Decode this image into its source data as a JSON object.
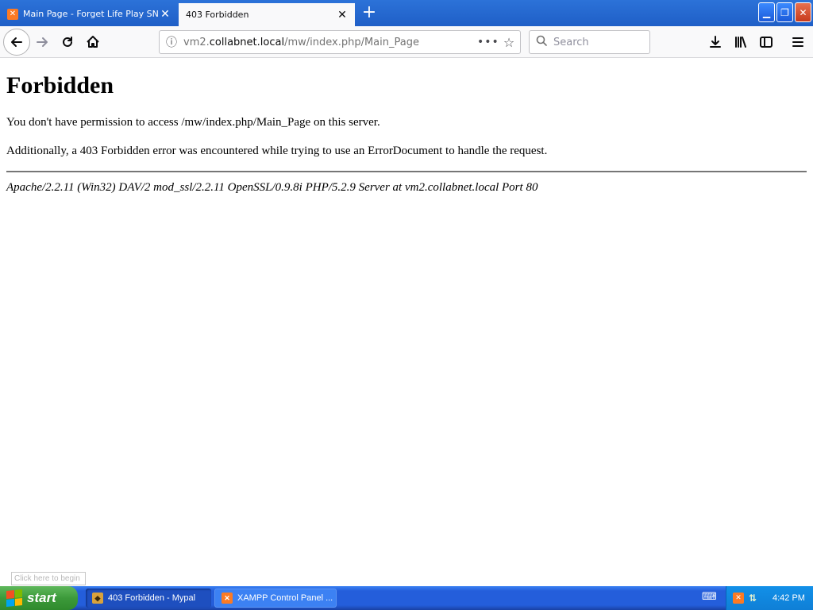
{
  "browser": {
    "tabs": [
      {
        "label": "Main Page - Forget Life Play SNOO",
        "favicon": "xampp-icon",
        "active": false
      },
      {
        "label": "403 Forbidden",
        "favicon": "",
        "active": true
      }
    ],
    "urlbar": {
      "prefix": "vm2.",
      "domain": "collabnet.local",
      "path": "/mw/index.php/Main_Page"
    },
    "search": {
      "placeholder": "Search"
    }
  },
  "page": {
    "heading": "Forbidden",
    "message1": "You don't have permission to access /mw/index.php/Main_Page on this server.",
    "message2": "Additionally, a 403 Forbidden error was encountered while trying to use an ErrorDocument to handle the request.",
    "server_signature": "Apache/2.2.11 (Win32) DAV/2 mod_ssl/2.2.11 OpenSSL/0.9.8i PHP/5.2.9 Server at vm2.collabnet.local Port 80"
  },
  "tooltip": "Click here to begin",
  "taskbar": {
    "start_label": "start",
    "tasks": [
      {
        "label": "403 Forbidden - Mypal",
        "active": true
      },
      {
        "label": "XAMPP Control Panel ...",
        "active": false
      }
    ],
    "clock": "4:42 PM"
  },
  "colors": {
    "titlebar": "#2c72d8",
    "taskbar": "#245edb",
    "start_button": "#3c9a3a",
    "tray": "#0f7fd6",
    "xampp_orange": "#fb7a24"
  }
}
